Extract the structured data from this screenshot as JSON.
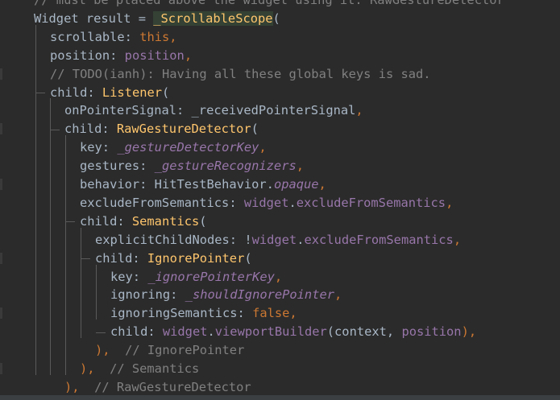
{
  "editor": {
    "lines": [
      {
        "indent": 42,
        "tokens": [
          {
            "text": "// must be placed above the widget using it: RawGestureDetector",
            "style": "comment"
          }
        ]
      },
      {
        "indent": 42,
        "tokens": [
          {
            "text": "Widget result = ",
            "style": "plain"
          },
          {
            "text": "_ScrollableScope",
            "style": "func-highlight"
          },
          {
            "text": "(",
            "style": "plain"
          }
        ]
      },
      {
        "indent": 62,
        "tokens": [
          {
            "text": "scrollable: ",
            "style": "plain"
          },
          {
            "text": "this",
            "style": "keyword"
          },
          {
            "text": ",",
            "style": "keyword"
          }
        ]
      },
      {
        "indent": 62,
        "tokens": [
          {
            "text": "position: ",
            "style": "plain"
          },
          {
            "text": "position",
            "style": "field"
          },
          {
            "text": ",",
            "style": "keyword"
          }
        ]
      },
      {
        "indent": 62,
        "tokens": [
          {
            "text": "// TODO(ianh): Having all these global keys is sad.",
            "style": "comment"
          }
        ]
      },
      {
        "indent": 62,
        "tokens": [
          {
            "text": "child: ",
            "style": "plain"
          },
          {
            "text": "Listener",
            "style": "func"
          },
          {
            "text": "(",
            "style": "plain"
          }
        ]
      },
      {
        "indent": 80,
        "tokens": [
          {
            "text": "onPointerSignal: ",
            "style": "plain"
          },
          {
            "text": "_receivedPointerSignal",
            "style": "plain"
          },
          {
            "text": ",",
            "style": "keyword"
          }
        ]
      },
      {
        "indent": 80,
        "tokens": [
          {
            "text": "child: ",
            "style": "plain"
          },
          {
            "text": "RawGestureDetector",
            "style": "func"
          },
          {
            "text": "(",
            "style": "plain"
          }
        ]
      },
      {
        "indent": 99,
        "tokens": [
          {
            "text": "key: ",
            "style": "plain"
          },
          {
            "text": "_gestureDetectorKey",
            "style": "field-italic"
          },
          {
            "text": ",",
            "style": "keyword"
          }
        ]
      },
      {
        "indent": 99,
        "tokens": [
          {
            "text": "gestures: ",
            "style": "plain"
          },
          {
            "text": "_gestureRecognizers",
            "style": "field-italic"
          },
          {
            "text": ",",
            "style": "keyword"
          }
        ]
      },
      {
        "indent": 99,
        "tokens": [
          {
            "text": "behavior: ",
            "style": "plain"
          },
          {
            "text": "HitTestBehavior.",
            "style": "plain"
          },
          {
            "text": "opaque",
            "style": "field-italic"
          },
          {
            "text": ",",
            "style": "keyword"
          }
        ]
      },
      {
        "indent": 99,
        "tokens": [
          {
            "text": "excludeFromSemantics: ",
            "style": "plain"
          },
          {
            "text": "widget",
            "style": "field"
          },
          {
            "text": ".",
            "style": "plain"
          },
          {
            "text": "excludeFromSemantics",
            "style": "field"
          },
          {
            "text": ",",
            "style": "keyword"
          }
        ]
      },
      {
        "indent": 99,
        "tokens": [
          {
            "text": "child: ",
            "style": "plain"
          },
          {
            "text": "Semantics",
            "style": "func"
          },
          {
            "text": "(",
            "style": "plain"
          }
        ]
      },
      {
        "indent": 118,
        "tokens": [
          {
            "text": "explicitChildNodes: !",
            "style": "plain"
          },
          {
            "text": "widget",
            "style": "field"
          },
          {
            "text": ".",
            "style": "plain"
          },
          {
            "text": "excludeFromSemantics",
            "style": "field"
          },
          {
            "text": ",",
            "style": "keyword"
          }
        ]
      },
      {
        "indent": 118,
        "tokens": [
          {
            "text": "child: ",
            "style": "plain"
          },
          {
            "text": "IgnorePointer",
            "style": "func"
          },
          {
            "text": "(",
            "style": "plain"
          }
        ]
      },
      {
        "indent": 137,
        "tokens": [
          {
            "text": "key: ",
            "style": "plain"
          },
          {
            "text": "_ignorePointerKey",
            "style": "field-italic"
          },
          {
            "text": ",",
            "style": "keyword"
          }
        ]
      },
      {
        "indent": 137,
        "tokens": [
          {
            "text": "ignoring: ",
            "style": "plain"
          },
          {
            "text": "_shouldIgnorePointer",
            "style": "field-italic"
          },
          {
            "text": ",",
            "style": "keyword"
          }
        ]
      },
      {
        "indent": 137,
        "tokens": [
          {
            "text": "ignoringSemantics: ",
            "style": "plain"
          },
          {
            "text": "false",
            "style": "keyword"
          },
          {
            "text": ",",
            "style": "keyword"
          }
        ]
      },
      {
        "indent": 137,
        "tokens": [
          {
            "text": "child: ",
            "style": "plain"
          },
          {
            "text": "widget",
            "style": "field"
          },
          {
            "text": ".",
            "style": "plain"
          },
          {
            "text": "viewportBuilder",
            "style": "field"
          },
          {
            "text": "(context, ",
            "style": "plain"
          },
          {
            "text": "position",
            "style": "field"
          },
          {
            "text": "),",
            "style": "keyword"
          }
        ]
      },
      {
        "indent": 118,
        "tokens": [
          {
            "text": "),  ",
            "style": "keyword"
          },
          {
            "text": "// IgnorePointer",
            "style": "comment"
          }
        ]
      },
      {
        "indent": 99,
        "tokens": [
          {
            "text": "),  ",
            "style": "keyword"
          },
          {
            "text": "// Semantics",
            "style": "comment"
          }
        ]
      },
      {
        "indent": 80,
        "tokens": [
          {
            "text": "),  ",
            "style": "keyword"
          },
          {
            "text": "// RawGestureDetector",
            "style": "comment"
          }
        ]
      }
    ]
  },
  "colors": {
    "background": "#2b2b2b",
    "plain": "#a9b7c6",
    "keyword": "#cc7832",
    "function": "#ffc66d",
    "field": "#9876aa",
    "comment": "#808080",
    "highlight": "#344134"
  }
}
